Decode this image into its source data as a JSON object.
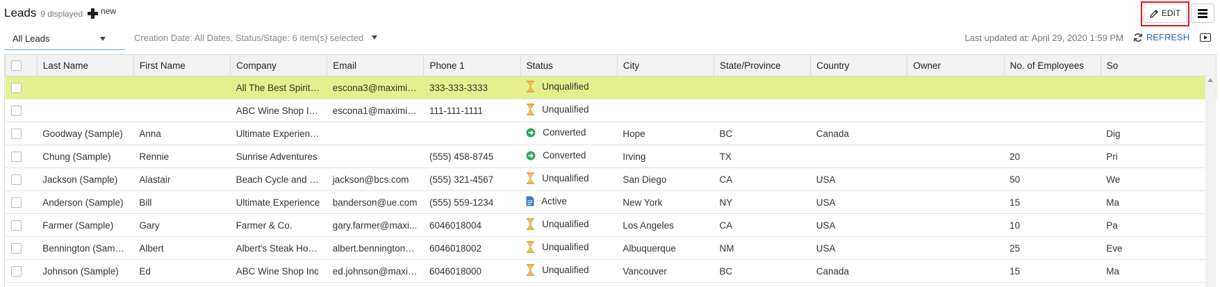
{
  "header": {
    "title": "Leads",
    "count_text": "9 displayed",
    "new_label": "new",
    "edit_label": "EDIT"
  },
  "toolbar": {
    "view_selected": "All Leads",
    "filter_summary": "Creation Date: All Dates, Status/Stage: 6 item(s) selected",
    "last_updated": "Last updated at: April 29, 2020 1:59 PM",
    "refresh_label": "REFRESH"
  },
  "table": {
    "columns": [
      "Last Name",
      "First Name",
      "Company",
      "Email",
      "Phone 1",
      "Status",
      "City",
      "State/Province",
      "Country",
      "Owner",
      "No. of Employees",
      "So"
    ],
    "rows": [
      {
        "highlighted": true,
        "last": "",
        "first": "",
        "company": "All The Best Spirits ...",
        "email": "escona3@maximiz...",
        "phone": "333-333-3333",
        "status": "Unqualified",
        "status_icon": "hourglass-icon",
        "city": "",
        "state": "",
        "country": "",
        "owner": "",
        "employees": "",
        "source": ""
      },
      {
        "highlighted": false,
        "last": "",
        "first": "",
        "company": "ABC Wine Shop Inc....",
        "email": "escona1@maximiz...",
        "phone": "111-111-1111",
        "status": "Unqualified",
        "status_icon": "hourglass-icon",
        "city": "",
        "state": "",
        "country": "",
        "owner": "",
        "employees": "",
        "source": ""
      },
      {
        "highlighted": false,
        "last": "Goodway (Sample)",
        "first": "Anna",
        "company": "Ultimate Experience.",
        "email": "",
        "phone": "",
        "status": "Converted",
        "status_icon": "converted-arrow-icon",
        "city": "Hope",
        "state": "BC",
        "country": "Canada",
        "owner": "",
        "employees": "",
        "source": "Dig"
      },
      {
        "highlighted": false,
        "last": "Chung (Sample)",
        "first": "Rennie",
        "company": "Sunrise Adventures",
        "email": "",
        "phone": "(555) 458-8745",
        "status": "Converted",
        "status_icon": "converted-arrow-icon",
        "city": "Irving",
        "state": "TX",
        "country": "",
        "owner": "",
        "employees": "20",
        "source": "Pri"
      },
      {
        "highlighted": false,
        "last": "Jackson (Sample)",
        "first": "Alastair",
        "company": "Beach Cycle and Sp...",
        "email": "jackson@bcs.com",
        "phone": "(555) 321-4567",
        "status": "Unqualified",
        "status_icon": "hourglass-icon",
        "city": "San Diego",
        "state": "CA",
        "country": "USA",
        "owner": "",
        "employees": "50",
        "source": "We"
      },
      {
        "highlighted": false,
        "last": "Anderson (Sample)",
        "first": "Bill",
        "company": "Ultimate Experience",
        "email": "banderson@ue.com",
        "phone": "(555) 559-1234",
        "status": "Active",
        "status_icon": "document-icon",
        "city": "New York",
        "state": "NY",
        "country": "USA",
        "owner": "",
        "employees": "15",
        "source": "Ma"
      },
      {
        "highlighted": false,
        "last": "Farmer (Sample)",
        "first": "Gary",
        "company": "Farmer & Co.",
        "email": "gary.farmer@maxi...",
        "phone": "6046018004",
        "status": "Unqualified",
        "status_icon": "hourglass-icon",
        "city": "Los Angeles",
        "state": "CA",
        "country": "USA",
        "owner": "",
        "employees": "10",
        "source": "Pa"
      },
      {
        "highlighted": false,
        "last": "Bennington (Sample)",
        "first": "Albert",
        "company": "Albert's Steak House",
        "email": "albert.bennington@...",
        "phone": "6046018002",
        "status": "Unqualified",
        "status_icon": "hourglass-icon",
        "city": "Albuquerque",
        "state": "NM",
        "country": "USA",
        "owner": "",
        "employees": "25",
        "source": "Eve"
      },
      {
        "highlighted": false,
        "last": "Johnson (Sample)",
        "first": "Ed",
        "company": "ABC Wine Shop Inc",
        "email": "ed.johnson@maxim...",
        "phone": "6046018000",
        "status": "Unqualified",
        "status_icon": "hourglass-icon",
        "city": "Vancouver",
        "state": "BC",
        "country": "Canada",
        "owner": "",
        "employees": "15",
        "source": "Ma"
      }
    ]
  },
  "colors": {
    "highlight_row": "#e4f08e",
    "edit_focus_border": "#e0161e",
    "link_blue": "#2a6db5",
    "hourglass": "#e8a93a",
    "converted": "#2fa84f",
    "active_doc": "#3b7bc9"
  }
}
